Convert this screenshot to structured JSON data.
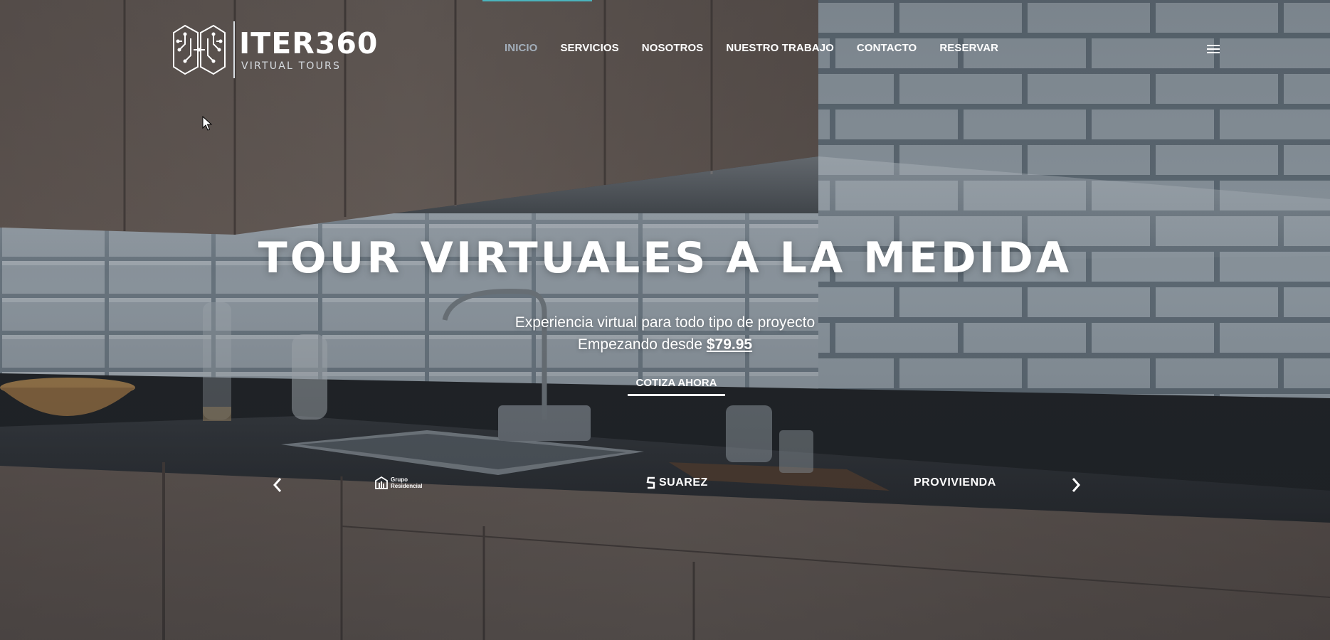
{
  "brand": {
    "name": "ITER360",
    "tagline": "VIRTUAL TOURS"
  },
  "nav": {
    "items": [
      {
        "label": "INICIO",
        "active": true
      },
      {
        "label": "SERVICIOS",
        "active": false
      },
      {
        "label": "NOSOTROS",
        "active": false
      },
      {
        "label": "NUESTRO TRABAJO",
        "active": false
      },
      {
        "label": "CONTACTO",
        "active": false
      },
      {
        "label": "RESERVAR",
        "active": false
      }
    ],
    "menu_icon": "hamburger-icon"
  },
  "hero": {
    "headline": "TOUR VIRTUALES A LA MEDIDA",
    "subline_1": "Experiencia virtual para todo tipo de proyecto",
    "subline_2_prefix": "Empezando desde ",
    "price": "$79.95",
    "cta_label": "COTIZA AHORA"
  },
  "clients": {
    "prev_icon": "chevron-left-icon",
    "next_icon": "chevron-right-icon",
    "logos": [
      {
        "line1": "Grupo",
        "line2": "Residencial"
      },
      {
        "name": "SUAREZ"
      },
      {
        "name": "PROVIVIENDA"
      }
    ]
  },
  "colors": {
    "accent": "#4ab3bd",
    "nav_active": "#a3afbb",
    "text": "#ffffff"
  }
}
